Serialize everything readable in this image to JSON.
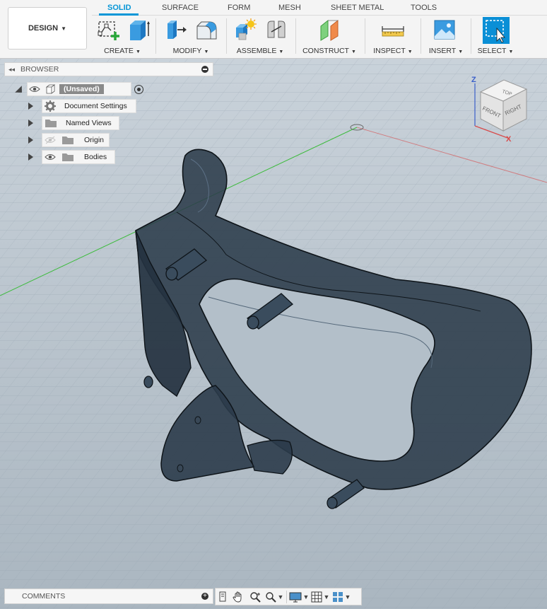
{
  "workspace": {
    "label": "DESIGN"
  },
  "tabs": [
    {
      "label": "SOLID",
      "active": true
    },
    {
      "label": "SURFACE"
    },
    {
      "label": "FORM"
    },
    {
      "label": "MESH"
    },
    {
      "label": "SHEET METAL"
    },
    {
      "label": "TOOLS"
    }
  ],
  "groups": [
    {
      "label": "CREATE"
    },
    {
      "label": "MODIFY"
    },
    {
      "label": "ASSEMBLE"
    },
    {
      "label": "CONSTRUCT"
    },
    {
      "label": "INSPECT"
    },
    {
      "label": "INSERT"
    },
    {
      "label": "SELECT"
    }
  ],
  "browser": {
    "title": "BROWSER",
    "root": "(Unsaved)",
    "items": [
      {
        "label": "Document Settings",
        "icon": "gear-icon"
      },
      {
        "label": "Named Views",
        "icon": "folder-icon"
      },
      {
        "label": "Origin",
        "icon": "folder-icon"
      },
      {
        "label": "Bodies",
        "icon": "folder-icon"
      }
    ]
  },
  "viewcube": {
    "top": "TOP",
    "front": "FRONT",
    "right": "RIGHT",
    "z_axis": "Z",
    "x_axis": "X"
  },
  "comments": {
    "title": "COMMENTS"
  },
  "colors": {
    "accent": "#0696d7",
    "model": "#2b3b4a",
    "grid_bg": "#b9c4cd"
  }
}
